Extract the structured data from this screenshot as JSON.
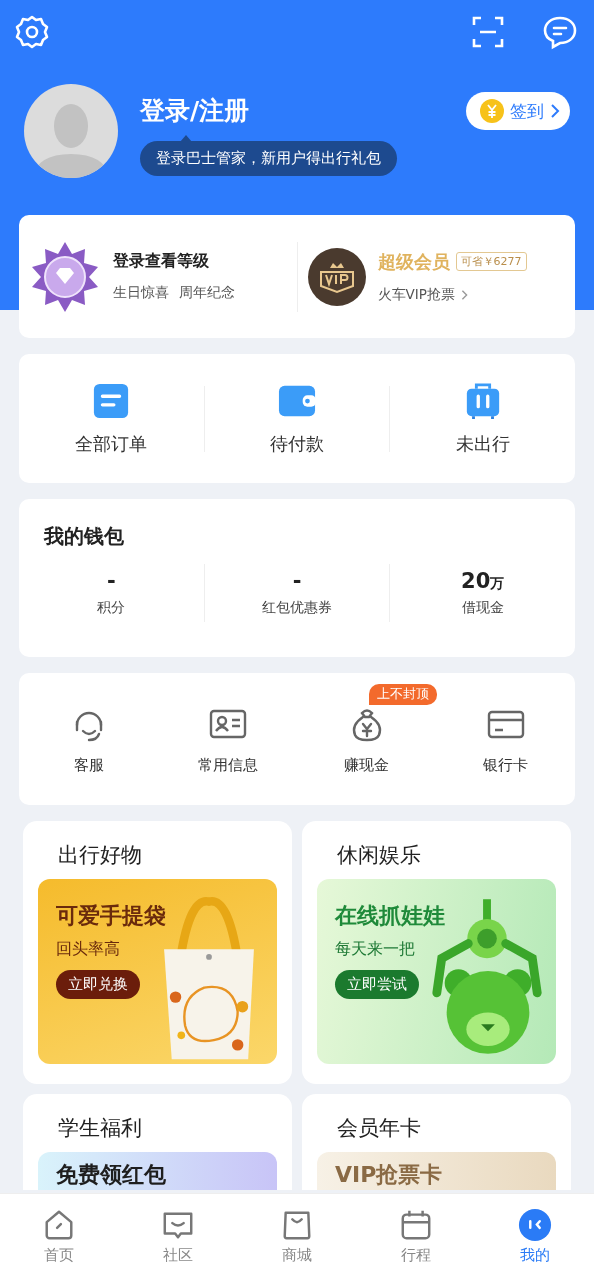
{
  "profile": {
    "login_title": "登录/注册",
    "tooltip": "登录巴士管家，新用户得出行礼包",
    "checkin": "签到"
  },
  "level_card": {
    "level": {
      "title": "登录查看等级",
      "perks": [
        "生日惊喜",
        "周年纪念"
      ]
    },
    "vip": {
      "title": "超级会员",
      "badge": "可省￥6277",
      "link": "火车VIP抢票"
    }
  },
  "orders": [
    {
      "kind": "list",
      "label": "全部订单"
    },
    {
      "kind": "wallet",
      "label": "待付款"
    },
    {
      "kind": "luggage",
      "label": "未出行"
    }
  ],
  "wallet": {
    "title": "我的钱包",
    "items": [
      {
        "value": "-",
        "label": "积分"
      },
      {
        "value": "-",
        "label": "红包优惠券"
      },
      {
        "value": "20",
        "unit": "万",
        "label": "借现金"
      }
    ]
  },
  "services": [
    {
      "kind": "headset",
      "label": "客服"
    },
    {
      "kind": "id-card",
      "label": "常用信息"
    },
    {
      "kind": "money-bag",
      "label": "赚现金",
      "badge": "上不封顶"
    },
    {
      "kind": "bank-card",
      "label": "银行卡"
    }
  ],
  "promos": [
    {
      "kind": "bag",
      "title": "出行好物",
      "headline": "可爱手提袋",
      "subline": "回头率高",
      "button": "立即兑换"
    },
    {
      "kind": "toy",
      "title": "休闲娱乐",
      "headline": "在线抓娃娃",
      "subline": "每天来一把",
      "button": "立即尝试"
    },
    {
      "kind": "student",
      "title": "学生福利",
      "headline": "免费领红包"
    },
    {
      "kind": "vip",
      "title": "会员年卡",
      "headline": "VIP抢票卡"
    }
  ],
  "nav": [
    {
      "kind": "home",
      "label": "首页",
      "selected": false
    },
    {
      "kind": "community",
      "label": "社区",
      "selected": false
    },
    {
      "kind": "shop",
      "label": "商城",
      "selected": false
    },
    {
      "kind": "trip",
      "label": "行程",
      "selected": false
    },
    {
      "kind": "mine",
      "label": "我的",
      "selected": true
    }
  ]
}
